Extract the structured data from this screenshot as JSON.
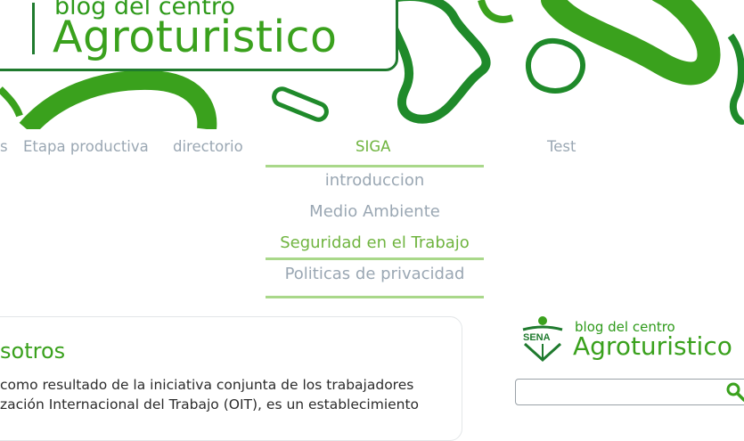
{
  "logo": {
    "subtitle": "blog del centro",
    "title": "Agroturistico"
  },
  "nav": {
    "items": [
      "s",
      "Etapa productiva",
      "directorio",
      "SIGA",
      "Test"
    ],
    "active": "SIGA"
  },
  "submenu": {
    "items": [
      "introduccion",
      "Medio Ambiente",
      "Seguridad en el Trabajo",
      "Politicas de privacidad"
    ],
    "active": "Seguridad en el Trabajo"
  },
  "content": {
    "title": "sotros",
    "line1": "como resultado de la iniciativa conjunta de los trabajadores",
    "line2": "zación Internacional del Trabajo (OIT), es un establecimiento"
  },
  "sidebar": {
    "logo_mark": "SENA",
    "subtitle": "blog del centro",
    "title": "Agroturistico"
  },
  "colors": {
    "brand_green": "#3aa11d",
    "dark_green": "#1f7a2e",
    "nav_gray": "#9aa7b3",
    "active_green": "#6fb43f"
  },
  "icons": [
    "search-icon",
    "sena-logo-icon"
  ]
}
